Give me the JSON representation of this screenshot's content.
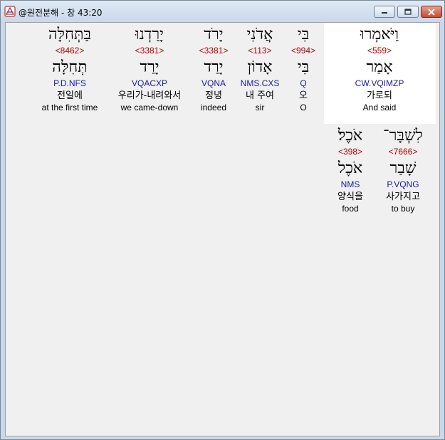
{
  "window": {
    "title": "@원전분해 - 창 43:20"
  },
  "words": [
    {
      "hebrew": "וַיֹּאמְרוּ",
      "strong": "<559>",
      "lemma": "אָמַר",
      "morph": "CW.VQIMZP",
      "korean": "가로되",
      "english": "And said"
    },
    {
      "hebrew": "בִּי",
      "strong": "<994>",
      "lemma": "בִּי",
      "morph": "Q",
      "korean": "오",
      "english": "O"
    },
    {
      "hebrew": "אֲדֹנִי",
      "strong": "<113>",
      "lemma": "אָדוֹן",
      "morph": "NMS.CXS",
      "korean": "내 주여",
      "english": "sir"
    },
    {
      "hebrew": "יָרֹד",
      "strong": "<3381>",
      "lemma": "יָרַד",
      "morph": "VQNA",
      "korean": "정녕",
      "english": "indeed"
    },
    {
      "hebrew": "יָרַדְנוּ",
      "strong": "<3381>",
      "lemma": "יָרַד",
      "morph": "VQACXP",
      "korean": "우리가-내려와서",
      "english": "we came-down"
    },
    {
      "hebrew": "בַּתְּחִלָּה",
      "strong": "<8462>",
      "lemma": "תְּחִלָּה",
      "morph": "P.D.NFS",
      "korean": "전일에",
      "english": "at the first time"
    },
    {
      "hebrew": "לִשְׁבָּר־",
      "strong": "<7666>",
      "lemma": "שָׁבַר",
      "morph": "P.VQNG",
      "korean": "사가지고",
      "english": "to buy"
    },
    {
      "hebrew": "אֹכֶל׃",
      "strong": "<398>",
      "lemma": "אֹכֶל",
      "morph": "NMS",
      "korean": "양식을",
      "english": "food"
    }
  ]
}
